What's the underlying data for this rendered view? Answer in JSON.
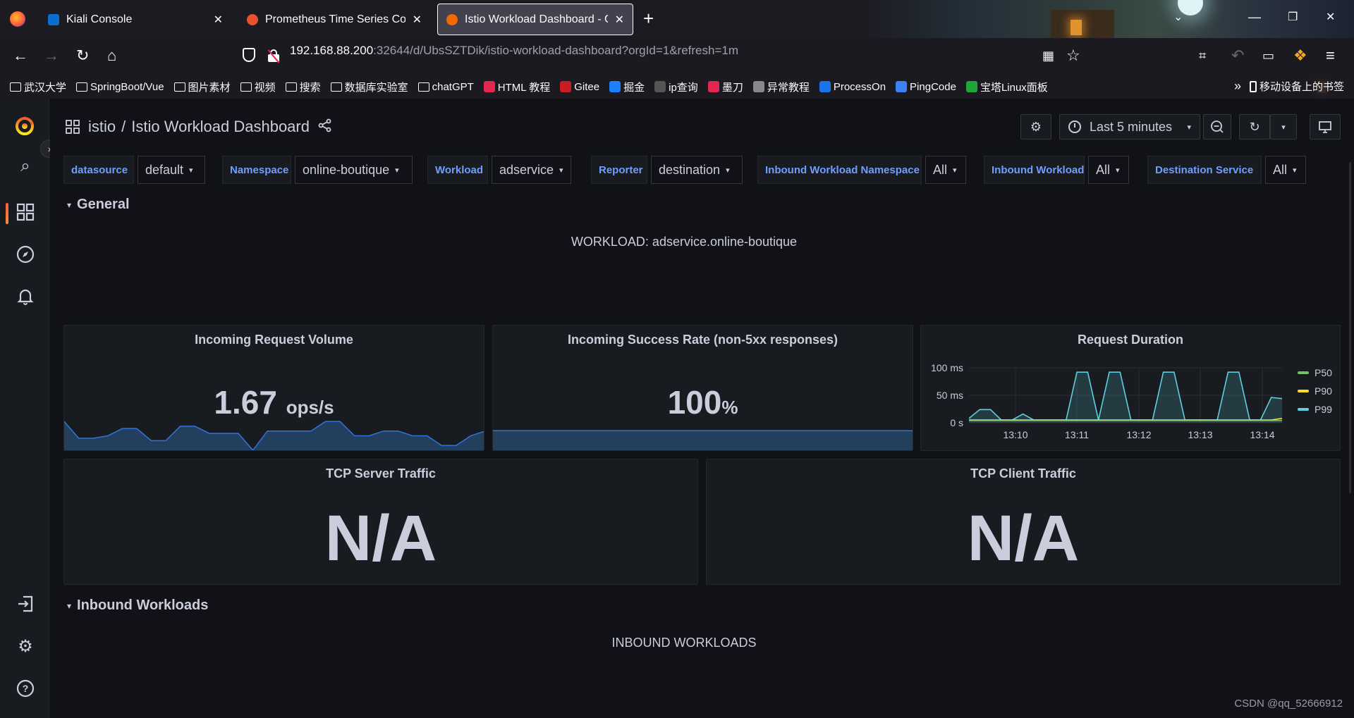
{
  "browser": {
    "tabs": [
      {
        "title": "Kiali Console",
        "favicon_color": "#0a6ed1"
      },
      {
        "title": "Prometheus Time Series Coll",
        "favicon_color": "#e6522c"
      },
      {
        "title": "Istio Workload Dashboard - G",
        "favicon_color": "#f46800"
      }
    ],
    "url_host": "192.168.88.200",
    "url_rest": ":32644/d/UbsSZTDik/istio-workload-dashboard?orgId=1&refresh=1m",
    "bookmarks": [
      {
        "label": "武汉大学",
        "icon": "folder-icon"
      },
      {
        "label": "SpringBoot/Vue",
        "icon": "folder-icon"
      },
      {
        "label": "图片素材",
        "icon": "folder-icon"
      },
      {
        "label": "视频",
        "icon": "folder-icon"
      },
      {
        "label": "搜索",
        "icon": "folder-icon"
      },
      {
        "label": "数据库实验室",
        "icon": "folder-icon"
      },
      {
        "label": "chatGPT",
        "icon": "folder-icon"
      },
      {
        "label": "HTML 教程",
        "icon": "runoob-icon",
        "color": "#e22850"
      },
      {
        "label": "Gitee",
        "icon": "gitee-icon",
        "color": "#c71d23"
      },
      {
        "label": "掘金",
        "icon": "juejin-icon",
        "color": "#1e80ff"
      },
      {
        "label": "ip查询",
        "icon": "ip-icon",
        "color": "#555555"
      },
      {
        "label": "墨刀",
        "icon": "modao-icon",
        "color": "#e22850"
      },
      {
        "label": "异常教程",
        "icon": "hand-icon",
        "color": "#888888"
      },
      {
        "label": "ProcessOn",
        "icon": "processon-icon",
        "color": "#1a73e8"
      },
      {
        "label": "PingCode",
        "icon": "pingcode-icon",
        "color": "#3b82f6"
      },
      {
        "label": "宝塔Linux面板",
        "icon": "baota-icon",
        "color": "#20a53a"
      }
    ],
    "mobile_bookmarks": "移动设备上的书签"
  },
  "dashboard": {
    "folder": "istio",
    "title": "Istio Workload Dashboard",
    "time_range": "Last 5 minutes",
    "variables": [
      {
        "label": "datasource",
        "value": "default"
      },
      {
        "label": "Namespace",
        "value": "online-boutique"
      },
      {
        "label": "Workload",
        "value": "adservice"
      },
      {
        "label": "Reporter",
        "value": "destination"
      },
      {
        "label": "Inbound Workload Namespace",
        "value": "All"
      },
      {
        "label": "Inbound Workload",
        "value": "All"
      },
      {
        "label": "Destination Service",
        "value": "All"
      }
    ],
    "rows": {
      "general": "General",
      "inbound": "Inbound Workloads"
    },
    "workload_text": "WORKLOAD: adservice.online-boutique",
    "inbound_text": "INBOUND WORKLOADS"
  },
  "panels": {
    "incoming_volume": {
      "title": "Incoming Request Volume",
      "value": "1.67",
      "unit": "ops/s"
    },
    "success_rate": {
      "title": "Incoming Success Rate (non-5xx responses)",
      "value": "100",
      "unit": "%"
    },
    "request_duration": {
      "title": "Request Duration"
    },
    "tcp_server": {
      "title": "TCP Server Traffic",
      "value": "N/A"
    },
    "tcp_client": {
      "title": "TCP Client Traffic",
      "value": "N/A"
    }
  },
  "chart_data": [
    {
      "type": "area",
      "name": "incoming-volume-sparkline",
      "values": [
        1.9,
        1.55,
        1.55,
        1.6,
        1.75,
        1.75,
        1.5,
        1.5,
        1.8,
        1.8,
        1.65,
        1.65,
        1.65,
        1.3,
        1.7,
        1.7,
        1.7,
        1.7,
        1.9,
        1.9,
        1.6,
        1.6,
        1.7,
        1.7,
        1.6,
        1.6,
        1.4,
        1.4,
        1.6,
        1.7
      ]
    },
    {
      "type": "area",
      "name": "success-rate-sparkline",
      "values": [
        100,
        100
      ]
    },
    {
      "type": "line",
      "title": "Request Duration",
      "x_ticks": [
        "13:10",
        "13:11",
        "13:12",
        "13:13",
        "13:14"
      ],
      "y_ticks": [
        "0 s",
        "50 ms",
        "100 ms"
      ],
      "ylim": [
        0,
        0.1
      ],
      "legend": "right",
      "series": [
        {
          "name": "P50",
          "color": "#73bf69",
          "values": [
            0.004,
            0.004,
            0.004,
            0.004,
            0.004,
            0.004,
            0.004,
            0.004,
            0.004,
            0.004,
            0.004,
            0.004,
            0.004,
            0.004,
            0.004,
            0.004,
            0.004,
            0.004,
            0.004,
            0.004,
            0.004,
            0.004,
            0.004,
            0.004,
            0.004,
            0.004,
            0.004,
            0.004,
            0.004,
            0.004
          ]
        },
        {
          "name": "P90",
          "color": "#fade2a",
          "values": [
            0.005,
            0.005,
            0.005,
            0.005,
            0.005,
            0.005,
            0.005,
            0.005,
            0.005,
            0.005,
            0.005,
            0.005,
            0.005,
            0.005,
            0.005,
            0.005,
            0.005,
            0.005,
            0.005,
            0.005,
            0.005,
            0.005,
            0.005,
            0.005,
            0.005,
            0.005,
            0.005,
            0.005,
            0.005,
            0.008
          ]
        },
        {
          "name": "P99",
          "color": "#5ecfe0",
          "values": [
            0.008,
            0.024,
            0.024,
            0.005,
            0.005,
            0.016,
            0.005,
            0.005,
            0.005,
            0.005,
            0.092,
            0.092,
            0.005,
            0.092,
            0.092,
            0.005,
            0.005,
            0.005,
            0.092,
            0.092,
            0.005,
            0.005,
            0.005,
            0.005,
            0.092,
            0.092,
            0.005,
            0.005,
            0.046,
            0.044
          ]
        }
      ]
    }
  ],
  "watermark": "CSDN @qq_52666912"
}
